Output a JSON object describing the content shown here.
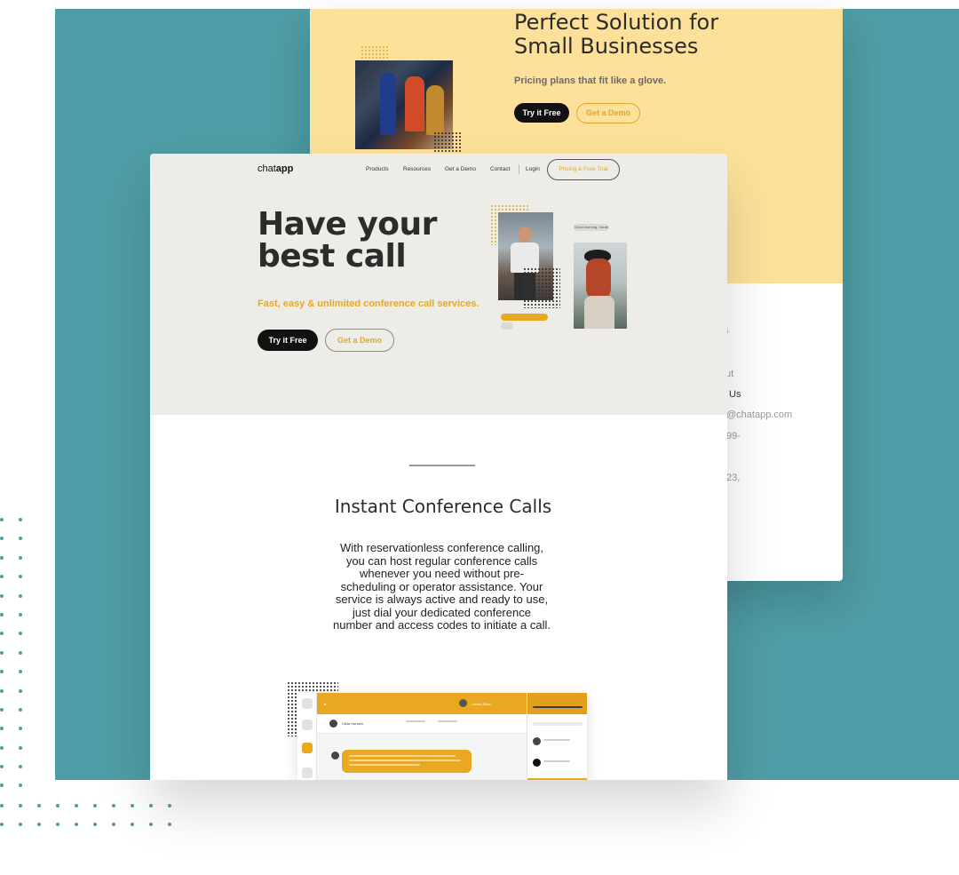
{
  "back_page": {
    "title": "Perfect Solution for Small Businesses",
    "subtitle": "Pricing plans that fit like a glove.",
    "try_free_label": "Try it Free",
    "get_demo_label": "Get a Demo",
    "footer_fragments": [
      "s",
      "ut",
      "Us",
      "@chatapp.com",
      "99-",
      "23,"
    ]
  },
  "front_page": {
    "logo_light": "chat",
    "logo_bold": "app",
    "nav": {
      "products": "Products",
      "resources": "Resources",
      "get_demo": "Get a Demo",
      "contact": "Contact",
      "login": "Login",
      "pricing_trial": "Pricing & Free Trial"
    },
    "hero": {
      "title": "Have your best call",
      "subtitle": "Fast, easy & unlimited conference call services.",
      "try_free_label": "Try it Free",
      "get_demo_label": "Get a Demo",
      "chip_greeting": "Good morning, Sarah"
    },
    "section": {
      "title": "Instant Conference Calls",
      "body": "With reservationless conference calling, you can host regular conference calls whenever you need without pre-scheduling or operator assistance. Your service is always active and ready to use, just dial your dedicated conference number and access codes to initiate a call."
    },
    "app_mockup": {
      "top_left": "Hilda Hansen",
      "top_user": "Lorna Oliver"
    }
  },
  "colors": {
    "teal": "#4f9da6",
    "yellow_bg": "#fde19a",
    "accent": "#e8a820",
    "hero_bg": "#eeece7"
  }
}
